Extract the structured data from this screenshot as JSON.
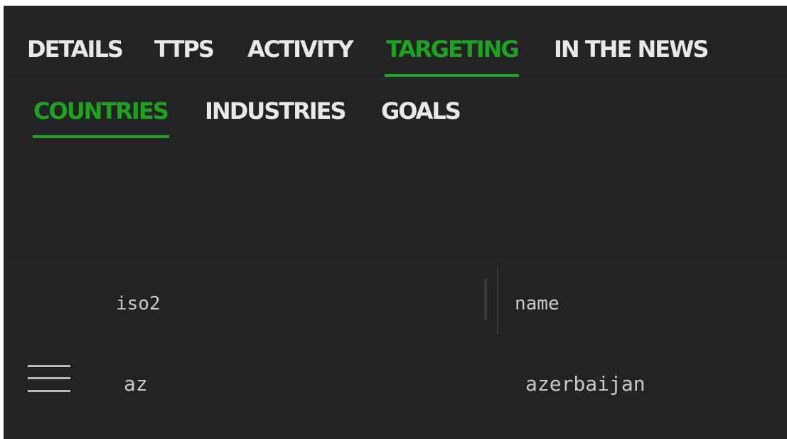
{
  "tabs": [
    {
      "label": "DETAILS",
      "active": false
    },
    {
      "label": "TTPS",
      "active": false
    },
    {
      "label": "ACTIVITY",
      "active": false
    },
    {
      "label": "TARGETING",
      "active": true
    },
    {
      "label": "IN THE NEWS",
      "active": false
    }
  ],
  "subtabs": [
    {
      "label": "COUNTRIES",
      "active": true
    },
    {
      "label": "INDUSTRIES",
      "active": false
    },
    {
      "label": "GOALS",
      "active": false
    }
  ],
  "table": {
    "columns": [
      "iso2",
      "name"
    ],
    "rows": [
      {
        "iso2": "az",
        "name": "azerbaijan"
      }
    ]
  },
  "colors": {
    "accent": "#1ea31e",
    "background": "#232326",
    "text": "#e8e8e8"
  },
  "icons": {
    "row_handle": "drag-handle-icon"
  }
}
